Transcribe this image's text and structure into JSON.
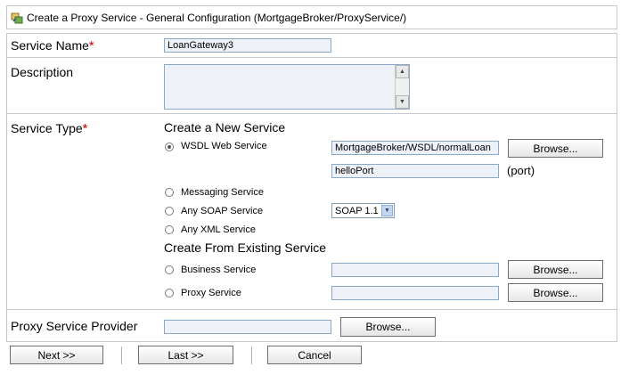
{
  "title": "Create a Proxy Service - General Configuration (MortgageBroker/ProxyService/)",
  "service_name": {
    "label": "Service Name",
    "required_mark": "*",
    "value": "LoanGateway3"
  },
  "description": {
    "label": "Description",
    "value": ""
  },
  "service_type": {
    "label": "Service Type",
    "required_mark": "*",
    "new_heading": "Create a New Service",
    "wsdl": {
      "label": "WSDL Web Service",
      "value": "MortgageBroker/WSDL/normalLoan",
      "browse": "Browse...",
      "port_value": "helloPort",
      "port_label": "(port)"
    },
    "messaging": {
      "label": "Messaging Service"
    },
    "soap": {
      "label": "Any SOAP Service",
      "select_value": "SOAP 1.1"
    },
    "xml": {
      "label": "Any XML Service"
    },
    "existing_heading": "Create From Existing Service",
    "business": {
      "label": "Business Service",
      "value": "",
      "browse": "Browse..."
    },
    "proxy": {
      "label": "Proxy Service",
      "value": "",
      "browse": "Browse..."
    }
  },
  "provider": {
    "label": "Proxy Service Provider",
    "value": "",
    "browse": "Browse..."
  },
  "footer": {
    "next": "Next >>",
    "last": "Last >>",
    "cancel": "Cancel"
  },
  "colors": {
    "required": "#cc0000",
    "input_bg": "#eef2f8",
    "input_border": "#8aa8c8",
    "border": "#c9c9c9"
  }
}
